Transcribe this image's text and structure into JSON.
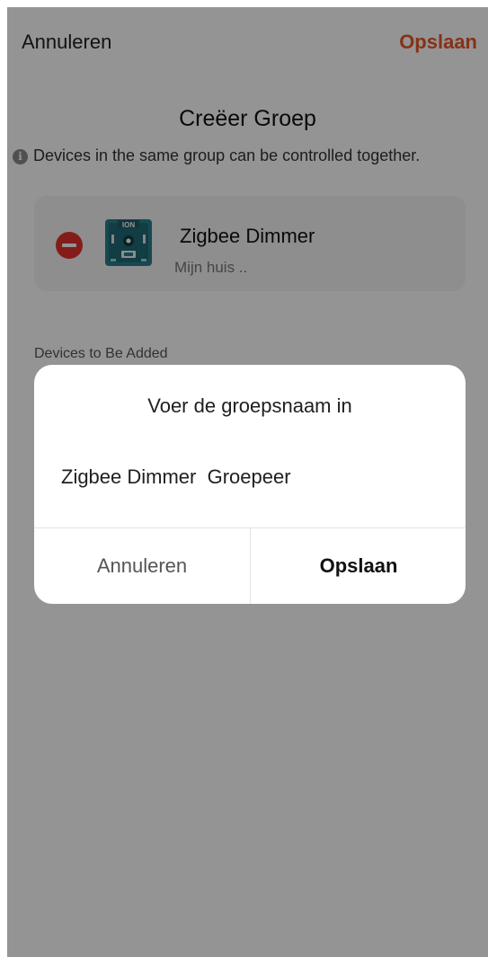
{
  "header": {
    "cancel_label": "Annuleren",
    "save_label": "Opslaan",
    "title": "Creëer Groep"
  },
  "hint": {
    "icon": "info-icon",
    "text": "Devices in the same group can be controlled together."
  },
  "devices": [
    {
      "name": "Zigbee Dimmer",
      "location": "Mijn huis ..",
      "thumb_label": "ION",
      "remove_icon": "minus-circle-icon"
    }
  ],
  "section": {
    "to_be_added_label": "Devices to Be Added"
  },
  "dialog": {
    "title": "Voer de groepsnaam in",
    "input_value": "Zigbee Dimmer  Groepeer",
    "cancel_label": "Annuleren",
    "save_label": "Opslaan"
  },
  "colors": {
    "accent": "#e8552a",
    "remove": "#e3332b",
    "device_body": "#2a7f8c"
  }
}
